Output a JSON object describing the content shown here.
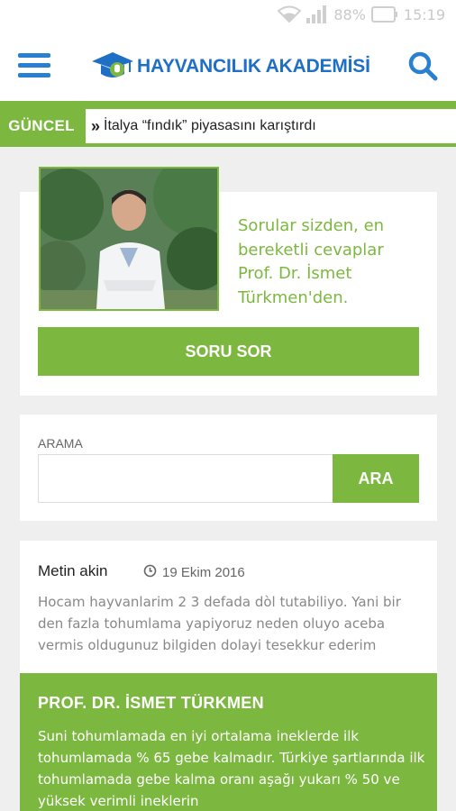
{
  "status_bar": {
    "battery": "88%",
    "time": "15:19"
  },
  "header": {
    "logo_text": "HAYVANCILIK AKADEMİSİ"
  },
  "ticker": {
    "label": "GÜNCEL",
    "headline": "İtalya “fındık” piyasasını karıştırdı"
  },
  "ask": {
    "text": "Sorular sizden, en bereketli cevaplar Prof. Dr. İsmet Türkmen'den.",
    "button_label": "SORU SOR"
  },
  "search": {
    "label": "ARAMA",
    "value": "",
    "button_label": "ARA"
  },
  "question": {
    "author": "Metin akin",
    "date": "19 Ekim 2016",
    "text": "Hocam hayvanlarim 2 3 defada dòl tutabiliyo. Yani bir den fazla tohumlama yapiyoruz neden oluyo aceba vermis oldugunuz bilgiden dolayi tesekkur ederim"
  },
  "answer": {
    "title": "PROF. DR. İSMET TÜRKMEN",
    "text": "Suni tohumlamada en iyi ortalama ineklerde ilk tohumlamada % 65 gebe kalmadır. Türkiye şartlarında ilk tohumlamada gebe kalma oranı aşağı yukarı % 50 ve yüksek verimli ineklerin"
  },
  "colors": {
    "accent_green": "#7cb83f",
    "brand_blue": "#2a7fd0"
  }
}
